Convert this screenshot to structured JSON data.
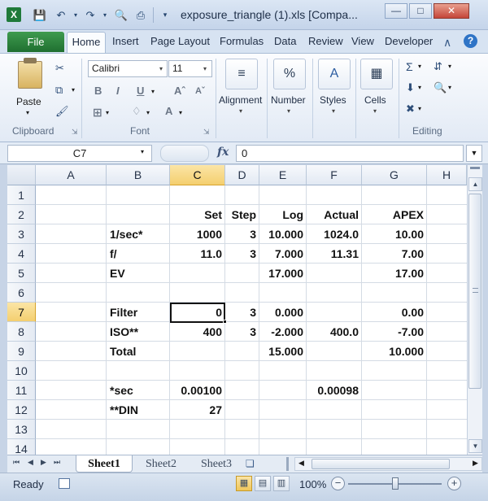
{
  "window": {
    "title": "exposure_triangle (1).xls  [Compa..."
  },
  "ribbon": {
    "tabs": [
      "File",
      "Home",
      "Insert",
      "Page Layout",
      "Formulas",
      "Data",
      "Review",
      "View",
      "Developer"
    ],
    "clipboard": {
      "label": "Clipboard",
      "paste": "Paste"
    },
    "font": {
      "label": "Font",
      "name": "Calibri",
      "size": "11"
    },
    "alignment": "Alignment",
    "number": "Number",
    "styles": "Styles",
    "cells": "Cells",
    "editing": "Editing"
  },
  "formula_bar": {
    "name_box": "C7",
    "fx": "fx",
    "value": "0"
  },
  "grid": {
    "columns": [
      "A",
      "B",
      "C",
      "D",
      "E",
      "F",
      "G",
      "H"
    ],
    "rows": [
      "1",
      "2",
      "3",
      "4",
      "5",
      "6",
      "7",
      "8",
      "9",
      "10",
      "11",
      "12",
      "13",
      "14"
    ],
    "selected_cell": "C7",
    "cells": {
      "r2": {
        "C": "Set",
        "D": "Step",
        "E": "Log",
        "F": "Actual",
        "G": "APEX"
      },
      "r3": {
        "B": "1/sec*",
        "C": "1000",
        "D": "3",
        "E": "10.000",
        "F": "1024.0",
        "G": "10.00"
      },
      "r4": {
        "B": "f/",
        "C": "11.0",
        "D": "3",
        "E": "7.000",
        "F": "11.31",
        "G": "7.00"
      },
      "r5": {
        "B": "EV",
        "E": "17.000",
        "G": "17.00"
      },
      "r7": {
        "B": "Filter",
        "C": "0",
        "D": "3",
        "E": "0.000",
        "G": "0.00"
      },
      "r8": {
        "B": "ISO**",
        "C": "400",
        "D": "3",
        "E": "-2.000",
        "F": "400.0",
        "G": "-7.00"
      },
      "r9": {
        "B": "Total",
        "E": "15.000",
        "G": "10.000"
      },
      "r11": {
        "B": "*sec",
        "C": "0.00100",
        "F": "0.00098"
      },
      "r12": {
        "B": "**DIN",
        "C": "27"
      }
    }
  },
  "sheets": [
    "Sheet1",
    "Sheet2",
    "Sheet3"
  ],
  "status": {
    "ready": "Ready",
    "zoom": "100%",
    "zoom_fraction": 0.5
  }
}
